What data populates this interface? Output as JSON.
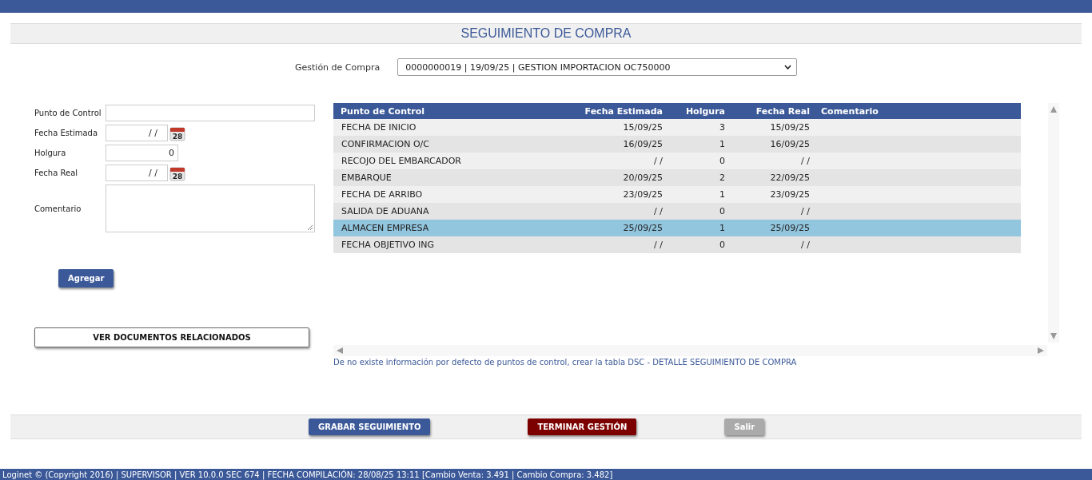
{
  "title": "SEGUIMIENTO DE COMPRA",
  "gestion": {
    "label": "Gestión de Compra",
    "value": "0000000019 | 19/09/25 | GESTION IMPORTACION OC750000"
  },
  "form": {
    "fields": [
      {
        "kind": "text",
        "label": "Punto de Control"
      },
      {
        "kind": "date",
        "label": "Fecha Estimada",
        "value": "/ /",
        "calendar_day": "28"
      },
      {
        "kind": "number",
        "label": "Holgura",
        "value": "0"
      },
      {
        "kind": "date",
        "label": "Fecha Real",
        "value": "/ /",
        "calendar_day": "28"
      },
      {
        "kind": "textarea",
        "label": "Comentario"
      }
    ],
    "add_button": "Agregar",
    "docs_button": "VER DOCUMENTOS RELACIONADOS"
  },
  "table": {
    "columns": [
      "Punto de Control",
      "Fecha Estimada",
      "Holgura",
      "Fecha Real",
      "Comentario"
    ],
    "rows": [
      {
        "cells": [
          "FECHA DE INICIO",
          "15/09/25",
          "3",
          "15/09/25",
          ""
        ],
        "selected": false
      },
      {
        "cells": [
          "CONFIRMACION O/C",
          "16/09/25",
          "1",
          "16/09/25",
          ""
        ],
        "selected": false
      },
      {
        "cells": [
          "RECOJO DEL EMBARCADOR",
          "/ /",
          "0",
          "/ /",
          ""
        ],
        "selected": false
      },
      {
        "cells": [
          "EMBARQUE",
          "20/09/25",
          "2",
          "22/09/25",
          ""
        ],
        "selected": false
      },
      {
        "cells": [
          "FECHA DE ARRIBO",
          "23/09/25",
          "1",
          "23/09/25",
          ""
        ],
        "selected": false
      },
      {
        "cells": [
          "SALIDA DE ADUANA",
          "/ /",
          "0",
          "/ /",
          ""
        ],
        "selected": false
      },
      {
        "cells": [
          "ALMACEN EMPRESA",
          "25/09/25",
          "1",
          "25/09/25",
          ""
        ],
        "selected": true
      },
      {
        "cells": [
          "FECHA OBJETIVO ING",
          "/ /",
          "0",
          "/ /",
          ""
        ],
        "selected": false
      }
    ]
  },
  "note": "De no existe información por defecto de puntos de control, crear la tabla DSC - DETALLE SEGUIMIENTO DE COMPRA",
  "actions": [
    {
      "kind": "primary",
      "label": "GRABAR SEGUIMIENTO",
      "disabled": false
    },
    {
      "kind": "danger",
      "label": "TERMINAR GESTIÓN",
      "disabled": false
    },
    {
      "kind": "plain",
      "label": "Salir",
      "disabled": true
    }
  ],
  "status_bar": "Loginet © (Copyright 2016) | SUPERVISOR | VER 10.0.0 SEC 674 | FECHA COMPILACIÓN: 28/08/25 13:11 [Cambio Venta: 3.491 | Cambio Compra: 3.482]"
}
